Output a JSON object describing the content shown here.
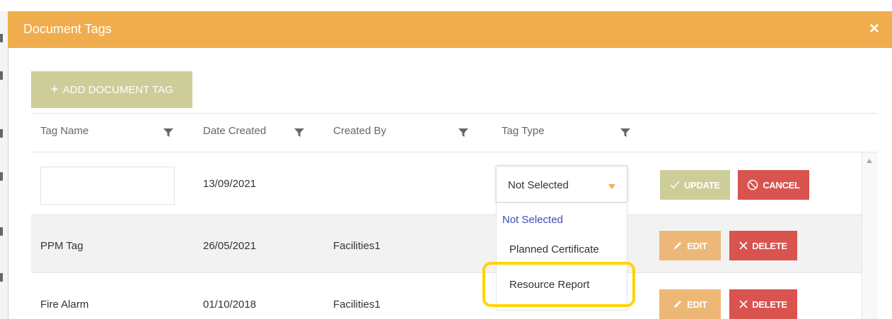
{
  "dialog": {
    "title": "Document Tags",
    "close_label": "×"
  },
  "toolbar": {
    "add_label": "ADD DOCUMENT TAG"
  },
  "columns": [
    "Tag Name",
    "Date Created",
    "Created By",
    "Tag Type"
  ],
  "edit_row": {
    "name_value": "",
    "date_created": "13/09/2021",
    "created_by": "",
    "tag_type_selected": "Not Selected",
    "update_label": "UPDATE",
    "cancel_label": "CANCEL"
  },
  "tag_type_options": [
    "Not Selected",
    "Planned Certificate",
    "Resource Report"
  ],
  "rows": [
    {
      "name": "PPM Tag",
      "date_created": "26/05/2021",
      "created_by": "Facilities1",
      "edit_label": "EDIT",
      "delete_label": "DELETE"
    },
    {
      "name": "Fire Alarm",
      "date_created": "01/10/2018",
      "created_by": "Facilities1",
      "edit_label": "EDIT",
      "delete_label": "DELETE"
    }
  ],
  "colors": {
    "header": "#f0ad4e",
    "add_button": "#cdcd9a",
    "danger": "#d9534f",
    "edit": "#edb877",
    "highlight": "#ffd400",
    "selected_option": "#3b4bb5"
  }
}
